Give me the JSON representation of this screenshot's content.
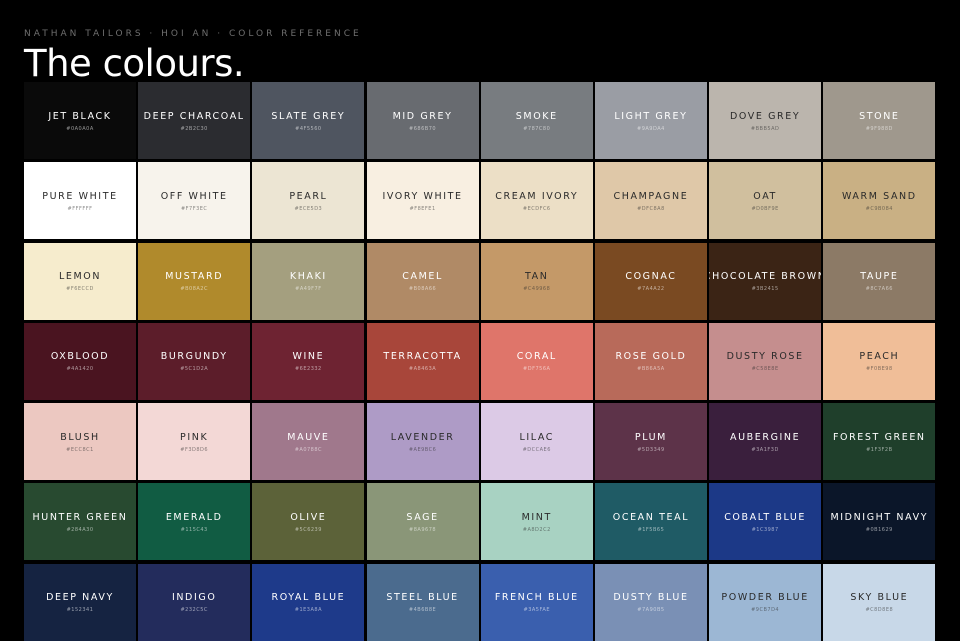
{
  "header": {
    "eyebrow": "NATHAN TAILORS · HOI AN · COLOR REFERENCE",
    "title": "The colours."
  },
  "swatches": [
    {
      "name": "JET BLACK",
      "hex": "#0A0A0A",
      "color": "#0A0A0A",
      "text": "#ffffff"
    },
    {
      "name": "DEEP CHARCOAL",
      "hex": "#2B2C30",
      "color": "#2B2C30",
      "text": "#ffffff"
    },
    {
      "name": "SLATE GREY",
      "hex": "#4F5560",
      "color": "#4F5560",
      "text": "#ffffff"
    },
    {
      "name": "MID GREY",
      "hex": "#686B70",
      "color": "#686B70",
      "text": "#ffffff"
    },
    {
      "name": "SMOKE",
      "hex": "#787C80",
      "color": "#787C80",
      "text": "#ffffff"
    },
    {
      "name": "LIGHT GREY",
      "hex": "#9A9DA4",
      "color": "#9A9DA4",
      "text": "#ffffff"
    },
    {
      "name": "DOVE GREY",
      "hex": "#BBB5AD",
      "color": "#BBB5AD",
      "text": "#2a2a2a"
    },
    {
      "name": "STONE",
      "hex": "#9F988D",
      "color": "#9F988D",
      "text": "#ffffff"
    },
    {
      "name": "PURE WHITE",
      "hex": "#FFFFFF",
      "color": "#FFFFFF",
      "text": "#2a2a2a"
    },
    {
      "name": "OFF WHITE",
      "hex": "#F7F3EC",
      "color": "#F7F3EC",
      "text": "#2a2a2a"
    },
    {
      "name": "PEARL",
      "hex": "#ECE5D3",
      "color": "#ECE5D3",
      "text": "#2a2a2a"
    },
    {
      "name": "IVORY WHITE",
      "hex": "#F8EFE1",
      "color": "#F8EFE1",
      "text": "#2a2a2a"
    },
    {
      "name": "CREAM IVORY",
      "hex": "#ECDFC6",
      "color": "#ECDFC6",
      "text": "#2a2a2a"
    },
    {
      "name": "CHAMPAGNE",
      "hex": "#DFC8A8",
      "color": "#DFC8A8",
      "text": "#2a2a2a"
    },
    {
      "name": "OAT",
      "hex": "#D0BF9E",
      "color": "#D0BF9E",
      "text": "#2a2a2a"
    },
    {
      "name": "WARM SAND",
      "hex": "#C9B084",
      "color": "#C9B084",
      "text": "#2a2a2a"
    },
    {
      "name": "LEMON",
      "hex": "#F6ECCD",
      "color": "#F6ECCD",
      "text": "#2a2a2a"
    },
    {
      "name": "MUSTARD",
      "hex": "#B08A2C",
      "color": "#B08A2C",
      "text": "#ffffff"
    },
    {
      "name": "KHAKI",
      "hex": "#A49F7F",
      "color": "#A49F7F",
      "text": "#ffffff"
    },
    {
      "name": "CAMEL",
      "hex": "#B08A66",
      "color": "#B08A66",
      "text": "#ffffff"
    },
    {
      "name": "TAN",
      "hex": "#C49968",
      "color": "#C49968",
      "text": "#2a2a2a"
    },
    {
      "name": "COGNAC",
      "hex": "#7A4A22",
      "color": "#7A4A22",
      "text": "#ffffff"
    },
    {
      "name": "CHOCOLATE BROWN",
      "hex": "#3B2415",
      "color": "#3B2415",
      "text": "#ffffff"
    },
    {
      "name": "TAUPE",
      "hex": "#8C7A66",
      "color": "#8C7A66",
      "text": "#ffffff"
    },
    {
      "name": "OXBLOOD",
      "hex": "#4A1420",
      "color": "#4A1420",
      "text": "#ffffff"
    },
    {
      "name": "BURGUNDY",
      "hex": "#5C1D2A",
      "color": "#5C1D2A",
      "text": "#ffffff"
    },
    {
      "name": "WINE",
      "hex": "#6E2332",
      "color": "#6E2332",
      "text": "#ffffff"
    },
    {
      "name": "TERRACOTTA",
      "hex": "#A8463A",
      "color": "#A8463A",
      "text": "#ffffff"
    },
    {
      "name": "CORAL",
      "hex": "#DF756A",
      "color": "#DF756A",
      "text": "#ffffff"
    },
    {
      "name": "ROSE GOLD",
      "hex": "#B86A5A",
      "color": "#B86A5A",
      "text": "#ffffff"
    },
    {
      "name": "DUSTY ROSE",
      "hex": "#C58E8E",
      "color": "#C58E8E",
      "text": "#2a2a2a"
    },
    {
      "name": "PEACH",
      "hex": "#F0BE98",
      "color": "#F0BE98",
      "text": "#2a2a2a"
    },
    {
      "name": "BLUSH",
      "hex": "#ECC8C1",
      "color": "#ECC8C1",
      "text": "#2a2a2a"
    },
    {
      "name": "PINK",
      "hex": "#F3D8D6",
      "color": "#F3D8D6",
      "text": "#2a2a2a"
    },
    {
      "name": "MAUVE",
      "hex": "#A0788C",
      "color": "#A0788C",
      "text": "#ffffff"
    },
    {
      "name": "LAVENDER",
      "hex": "#AE9BC6",
      "color": "#AE9BC6",
      "text": "#2a2a2a"
    },
    {
      "name": "LILAC",
      "hex": "#DCCAE6",
      "color": "#DCCAE6",
      "text": "#2a2a2a"
    },
    {
      "name": "PLUM",
      "hex": "#5D3349",
      "color": "#5D3349",
      "text": "#ffffff"
    },
    {
      "name": "AUBERGINE",
      "hex": "#3A1F3D",
      "color": "#3A1F3D",
      "text": "#ffffff"
    },
    {
      "name": "FOREST GREEN",
      "hex": "#1F3F2B",
      "color": "#1F3F2B",
      "text": "#ffffff"
    },
    {
      "name": "HUNTER GREEN",
      "hex": "#284A30",
      "color": "#284A30",
      "text": "#ffffff"
    },
    {
      "name": "EMERALD",
      "hex": "#115C43",
      "color": "#115C43",
      "text": "#ffffff"
    },
    {
      "name": "OLIVE",
      "hex": "#5C6239",
      "color": "#5C6239",
      "text": "#ffffff"
    },
    {
      "name": "SAGE",
      "hex": "#8A9678",
      "color": "#8A9678",
      "text": "#ffffff"
    },
    {
      "name": "MINT",
      "hex": "#A8D2C2",
      "color": "#A8D2C2",
      "text": "#2a2a2a"
    },
    {
      "name": "OCEAN TEAL",
      "hex": "#1F5B65",
      "color": "#1F5B65",
      "text": "#ffffff"
    },
    {
      "name": "COBALT BLUE",
      "hex": "#1C3987",
      "color": "#1C3987",
      "text": "#ffffff"
    },
    {
      "name": "MIDNIGHT NAVY",
      "hex": "#0B1629",
      "color": "#0B1629",
      "text": "#ffffff"
    },
    {
      "name": "DEEP NAVY",
      "hex": "#152341",
      "color": "#152341",
      "text": "#ffffff"
    },
    {
      "name": "INDIGO",
      "hex": "#232C5C",
      "color": "#232C5C",
      "text": "#ffffff"
    },
    {
      "name": "ROYAL BLUE",
      "hex": "#1E3A8A",
      "color": "#1E3A8A",
      "text": "#ffffff"
    },
    {
      "name": "STEEL BLUE",
      "hex": "#4B6B8E",
      "color": "#4B6B8E",
      "text": "#ffffff"
    },
    {
      "name": "FRENCH BLUE",
      "hex": "#3A5FAE",
      "color": "#3A5FAE",
      "text": "#ffffff"
    },
    {
      "name": "DUSTY BLUE",
      "hex": "#7A90B5",
      "color": "#7A90B5",
      "text": "#ffffff"
    },
    {
      "name": "POWDER BLUE",
      "hex": "#9CB7D4",
      "color": "#9CB7D4",
      "text": "#2a2a2a"
    },
    {
      "name": "SKY BLUE",
      "hex": "#C8D8E8",
      "color": "#C8D8E8",
      "text": "#2a2a2a"
    }
  ]
}
